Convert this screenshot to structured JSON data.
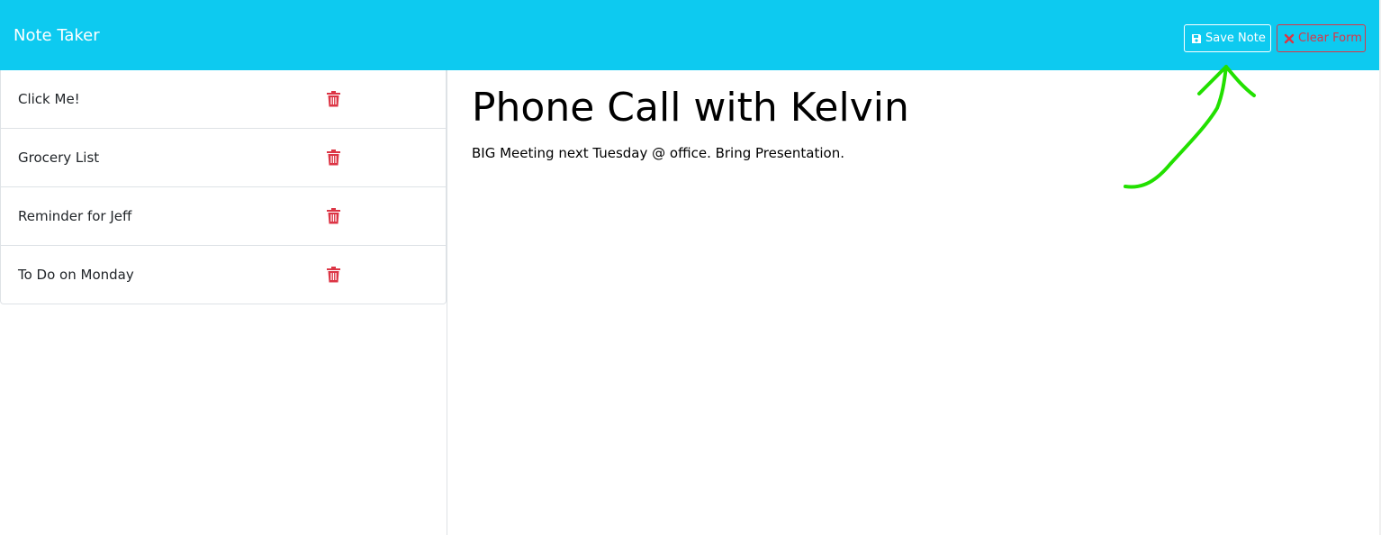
{
  "navbar": {
    "brand": "Note Taker",
    "save_label": "Save Note",
    "clear_label": "Clear Form",
    "save_icon": "floppy-disk-icon",
    "clear_icon": "x-mark-icon"
  },
  "notes": [
    {
      "title": "Click Me!"
    },
    {
      "title": "Grocery List"
    },
    {
      "title": "Reminder for Jeff"
    },
    {
      "title": "To Do on Monday"
    }
  ],
  "active_note": {
    "title": "Phone Call with Kelvin",
    "text": "BIG Meeting next Tuesday @ office. Bring Presentation."
  },
  "colors": {
    "navbar_bg": "#0dcaf0",
    "danger": "#dc3545",
    "annotation_arrow": "#22e000"
  },
  "icons": {
    "delete": "trash-icon",
    "annotation": "hand-drawn-arrow"
  }
}
